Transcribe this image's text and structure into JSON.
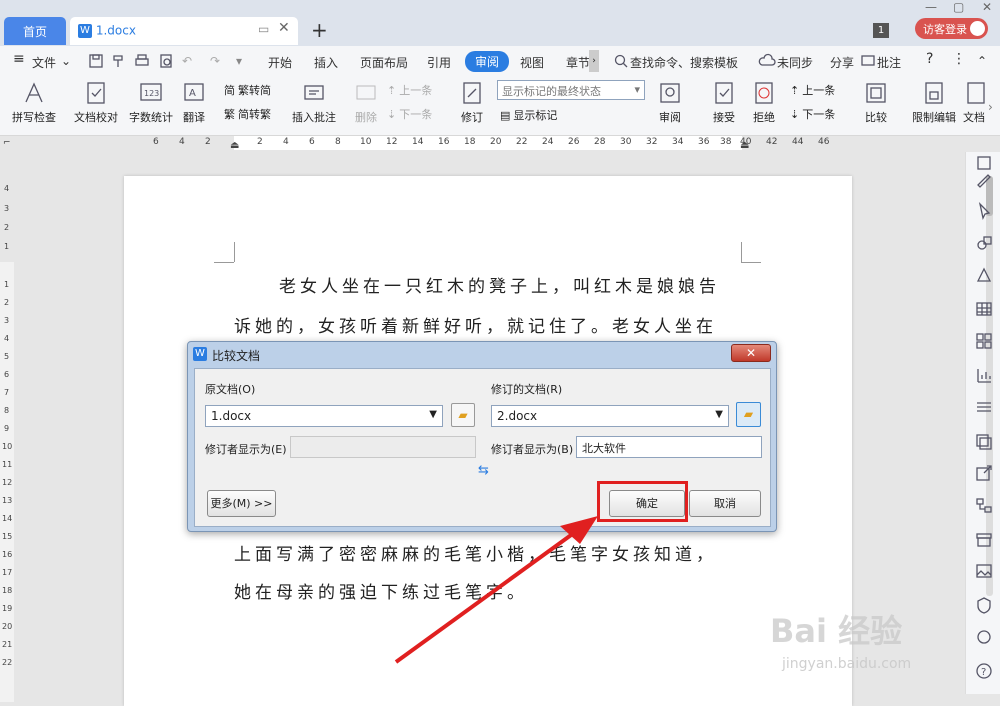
{
  "tabs": {
    "home": "首页",
    "doc": "1.docx",
    "plus": "+"
  },
  "window": {
    "badge": "1",
    "login": "访客登录"
  },
  "menu": {
    "file": "文件",
    "items": [
      "开始",
      "插入",
      "页面布局",
      "引用",
      "审阅",
      "视图",
      "章节"
    ],
    "active": "审阅",
    "search": "查找命令、搜索模板",
    "sync": "未同步",
    "share": "分享",
    "comment": "批注"
  },
  "ribbon": {
    "spell": "拼写检查",
    "proof": "文档校对",
    "count": "字数统计",
    "translate": "翻译",
    "t2s": "繁转简",
    "s2t": "简转繁",
    "insert_comment": "插入批注",
    "delete": "删除",
    "prev_c": "上一条",
    "next_c": "下一条",
    "revise": "修订",
    "markup_mode": "显示标记的最终状态",
    "show_markup": "显示标记",
    "review": "审阅",
    "accept": "接受",
    "reject": "拒绝",
    "prev": "上一条",
    "next": "下一条",
    "compare": "比较",
    "restrict": "限制编辑",
    "doc_perm": "文档"
  },
  "ruler": {
    "nums": [
      "6",
      "4",
      "2",
      "2",
      "4",
      "6",
      "8",
      "10",
      "12",
      "14",
      "16",
      "18",
      "20",
      "22",
      "24",
      "26",
      "28",
      "30",
      "32",
      "34",
      "36",
      "38",
      "40",
      "42",
      "44",
      "46"
    ],
    "vnums": [
      "4",
      "3",
      "2",
      "1",
      "1",
      "2",
      "3",
      "4",
      "5",
      "6",
      "7",
      "8",
      "9",
      "10",
      "11",
      "12",
      "13",
      "14",
      "15",
      "16",
      "17",
      "18",
      "19",
      "20",
      "21",
      "22"
    ]
  },
  "document": {
    "lines": [
      "老女人坐在一只红木的凳子上，叫红木是娘娘告",
      "诉她的，女孩听着新鲜好听，就记住了。老女人坐在",
      "上面写满了密密麻麻的毛笔小楷，毛笔字女孩知道，",
      "她在母亲的强迫下练过毛笔字。"
    ]
  },
  "dialog": {
    "title": "比较文档",
    "orig_label": "原文档(O)",
    "orig_value": "1.docx",
    "rev_label": "修订的文档(R)",
    "rev_value": "2.docx",
    "author_label_left": "修订者显示为(E)",
    "author_label_right": "修订者显示为(B)",
    "author_value_right": "北大软件",
    "more": "更多(M) >>",
    "ok": "确定",
    "cancel": "取消"
  },
  "watermark": {
    "brand": "Bai 经验",
    "url": "jingyan.baidu.com"
  },
  "colors": {
    "accent": "#2b7de1",
    "highlight": "#e02020",
    "login": "#d9534f"
  }
}
